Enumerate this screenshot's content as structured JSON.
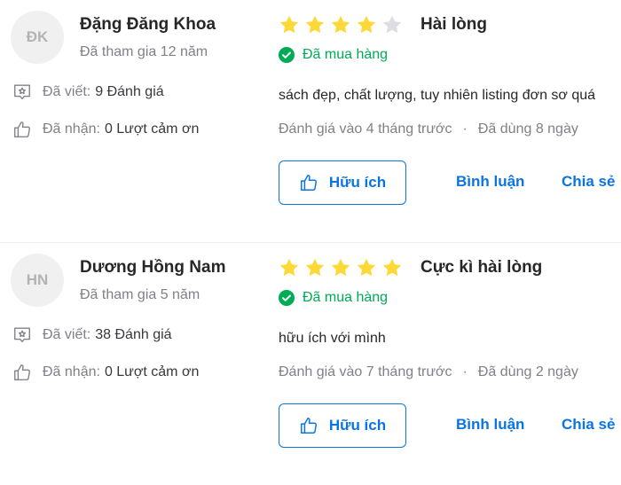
{
  "colors": {
    "accent": "#0b74e5",
    "star_filled": "#fdd836",
    "star_empty": "#dddde3",
    "verified": "#00ab56"
  },
  "reviews": [
    {
      "avatar_initials": "ĐK",
      "name": "Đặng Đăng Khoa",
      "joined": "Đã tham gia 12 năm",
      "written_label": "Đã viết:",
      "written_value": "9 Đánh giá",
      "thanks_label": "Đã nhận:",
      "thanks_value": "0 Lượt cảm ơn",
      "rating": 4,
      "rating_max": 5,
      "rating_text": "Hài lòng",
      "purchased_label": "Đã mua hàng",
      "content": "sách đẹp, chất lượng, tuy nhiên listing đơn sơ quá",
      "reviewed_at": "Đánh giá vào 4 tháng trước",
      "used_for": "Đã dùng 8 ngày",
      "helpful_label": "Hữu ích",
      "comment_label": "Bình luận",
      "share_label": "Chia sẻ"
    },
    {
      "avatar_initials": "HN",
      "name": "Dương Hồng Nam",
      "joined": "Đã tham gia 5 năm",
      "written_label": "Đã viết:",
      "written_value": "38 Đánh giá",
      "thanks_label": "Đã nhận:",
      "thanks_value": "0 Lượt cảm ơn",
      "rating": 5,
      "rating_max": 5,
      "rating_text": "Cực kì hài lòng",
      "purchased_label": "Đã mua hàng",
      "content": "hữu ích với mình",
      "reviewed_at": "Đánh giá vào 7 tháng trước",
      "used_for": "Đã dùng 2 ngày",
      "helpful_label": "Hữu ích",
      "comment_label": "Bình luận",
      "share_label": "Chia sẻ"
    }
  ]
}
